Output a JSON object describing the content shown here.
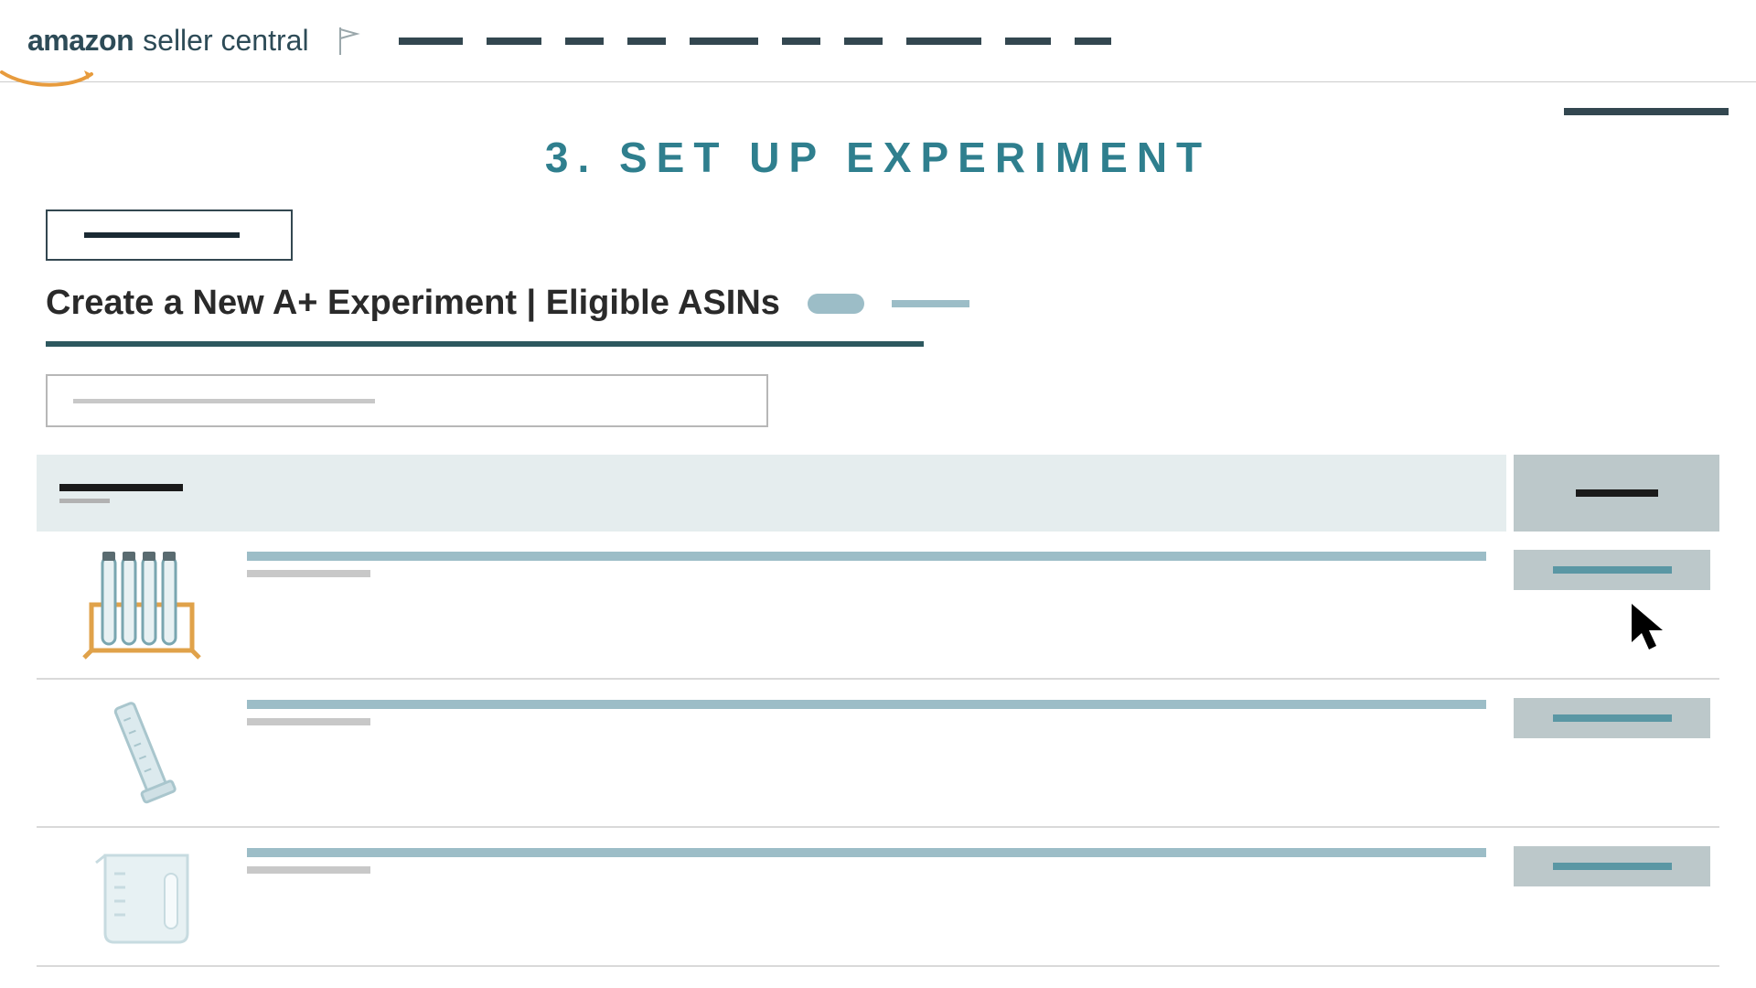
{
  "header": {
    "logo_amazon": "amazon",
    "logo_seller_central": "seller central",
    "nav_widths": [
      70,
      60,
      42,
      42,
      75,
      42,
      42,
      82,
      50,
      40
    ]
  },
  "step_title": "3. SET UP EXPERIMENT",
  "page_heading": "Create a New A+ Experiment  |  Eligible ASINs",
  "rows": [
    {
      "icon": "test-tubes"
    },
    {
      "icon": "cylinder"
    },
    {
      "icon": "beaker"
    }
  ]
}
